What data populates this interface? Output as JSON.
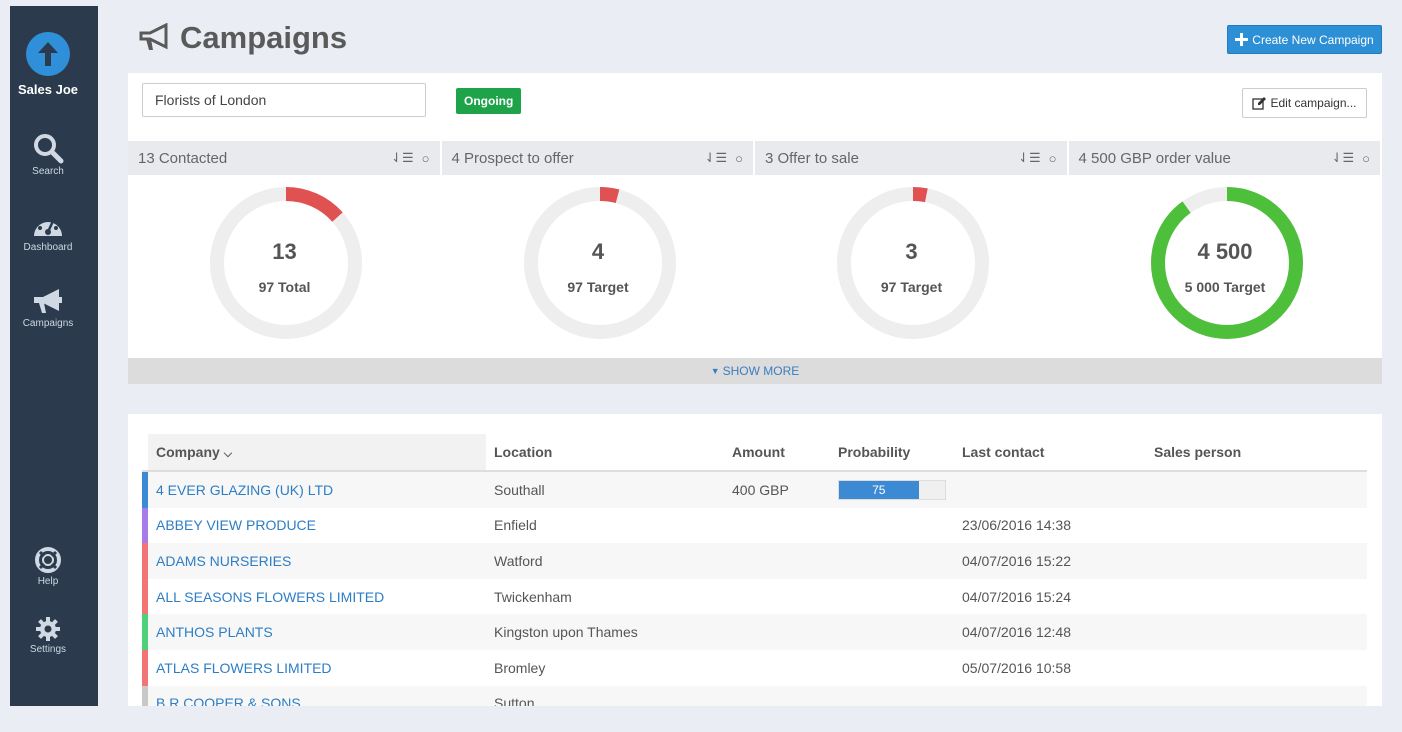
{
  "sidebar": {
    "brand": "Sales Joe",
    "items": [
      {
        "label": "Search",
        "icon": "search-icon"
      },
      {
        "label": "Dashboard",
        "icon": "dashboard-icon"
      },
      {
        "label": "Campaigns",
        "icon": "megaphone-icon"
      },
      {
        "label": "Help",
        "icon": "lifebuoy-icon"
      },
      {
        "label": "Settings",
        "icon": "gear-icon"
      }
    ]
  },
  "header": {
    "title": "Campaigns",
    "create_button": "Create New Campaign"
  },
  "campaign": {
    "name": "Florists of London",
    "status": "Ongoing",
    "edit_button": "Edit campaign..."
  },
  "stats": [
    {
      "header": "13 Contacted",
      "value": "13",
      "sub": "97 Total",
      "progress": 0.134,
      "color": "#e05252"
    },
    {
      "header": "4 Prospect to offer",
      "value": "4",
      "sub": "97 Target",
      "progress": 0.041,
      "color": "#e05252"
    },
    {
      "header": "3 Offer to sale",
      "value": "3",
      "sub": "97 Target",
      "progress": 0.031,
      "color": "#e05252"
    },
    {
      "header": "4 500 GBP order value",
      "value": "4 500",
      "sub": "5 000 Target",
      "progress": 0.9,
      "color": "#4dbf3a"
    }
  ],
  "show_more": "SHOW MORE",
  "table": {
    "columns": [
      "Company",
      "Location",
      "Amount",
      "Probability",
      "Last contact",
      "Sales person"
    ],
    "rows": [
      {
        "company": "4 EVER GLAZING (UK) LTD",
        "location": "Southall",
        "amount": "400 GBP",
        "probability": "75",
        "probability_value": 0.75,
        "last_contact": "",
        "stripe": "#3b8ad3"
      },
      {
        "company": "ABBEY VIEW PRODUCE",
        "location": "Enfield",
        "amount": "",
        "probability": "",
        "last_contact": "23/06/2016 14:38",
        "stripe": "#a77be8"
      },
      {
        "company": "ADAMS NURSERIES",
        "location": "Watford",
        "amount": "",
        "probability": "",
        "last_contact": "04/07/2016 15:22",
        "stripe": "#f27474"
      },
      {
        "company": "ALL SEASONS FLOWERS LIMITED",
        "location": "Twickenham",
        "amount": "",
        "probability": "",
        "last_contact": "04/07/2016 15:24",
        "stripe": "#f27474"
      },
      {
        "company": "ANTHOS PLANTS",
        "location": "Kingston upon Thames",
        "amount": "",
        "probability": "",
        "last_contact": "04/07/2016 12:48",
        "stripe": "#4fd07a"
      },
      {
        "company": "ATLAS FLOWERS LIMITED",
        "location": "Bromley",
        "amount": "",
        "probability": "",
        "last_contact": "05/07/2016 10:58",
        "stripe": "#f27474"
      },
      {
        "company": "B R COOPER & SONS",
        "location": "Sutton",
        "amount": "",
        "probability": "",
        "last_contact": "",
        "stripe": "#c8c8c8"
      }
    ]
  }
}
